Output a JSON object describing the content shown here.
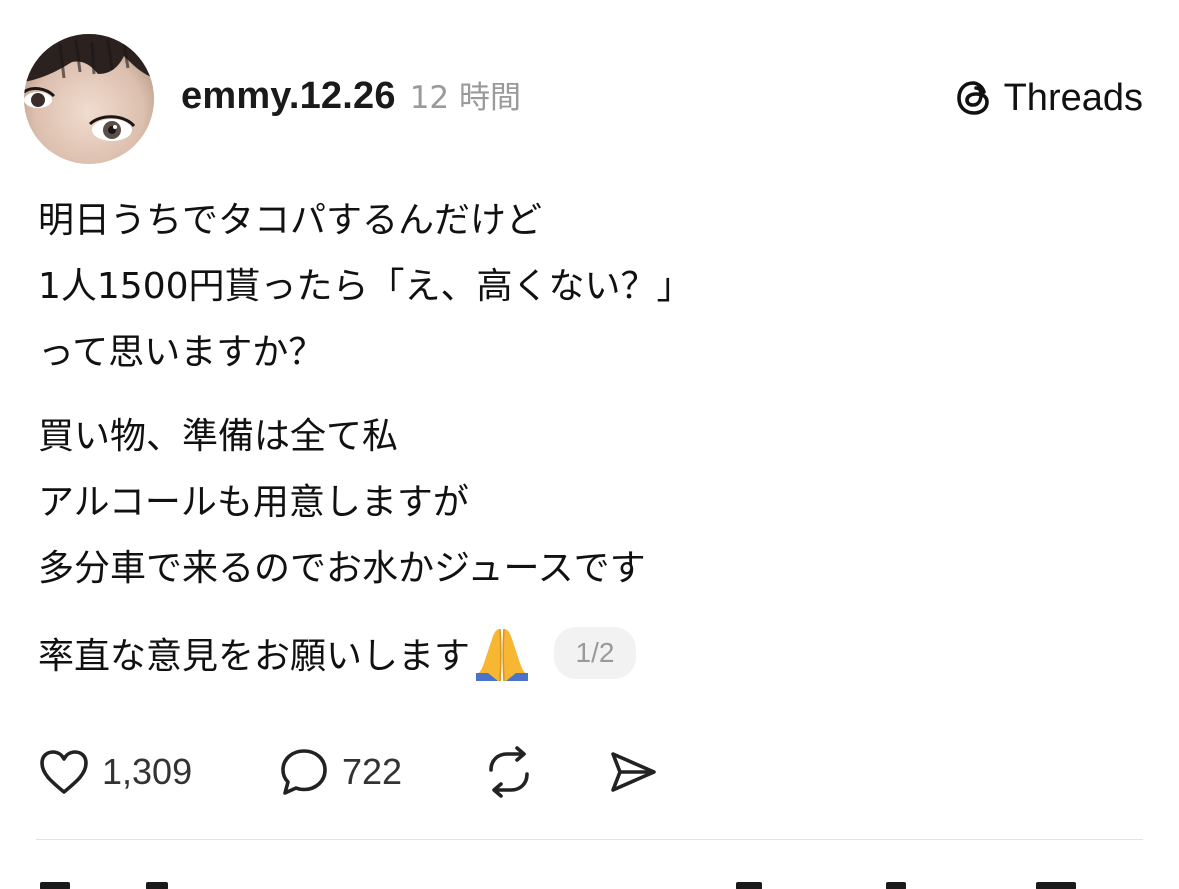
{
  "post": {
    "username": "emmy.12.26",
    "time_ago": "12 時間",
    "brand": {
      "name": "Threads",
      "icon": "threads-logo-icon"
    },
    "paragraphs": [
      {
        "lines": [
          "明日うちでタコパするんだけど",
          "1人1500円貰ったら「え、高くない？」",
          "って思いますか？"
        ]
      },
      {
        "lines": [
          "買い物、準備は全て私",
          "アルコールも用意しますが",
          "多分車で来るのでお水かジュースです"
        ]
      }
    ],
    "closing_line": "率直な意見をお願いします",
    "closing_emoji": "folded-hands-emoji",
    "page_indicator": "1/2",
    "actions": {
      "like": {
        "icon": "heart-icon",
        "count": "1,309"
      },
      "reply": {
        "icon": "comment-bubble-icon",
        "count": "722"
      },
      "repost": {
        "icon": "repost-icon"
      },
      "share": {
        "icon": "send-icon"
      }
    }
  },
  "colors": {
    "text": "#111111",
    "muted": "#9a9a9a",
    "divider": "#e3e3e3",
    "badge_bg": "#f2f2f2"
  }
}
